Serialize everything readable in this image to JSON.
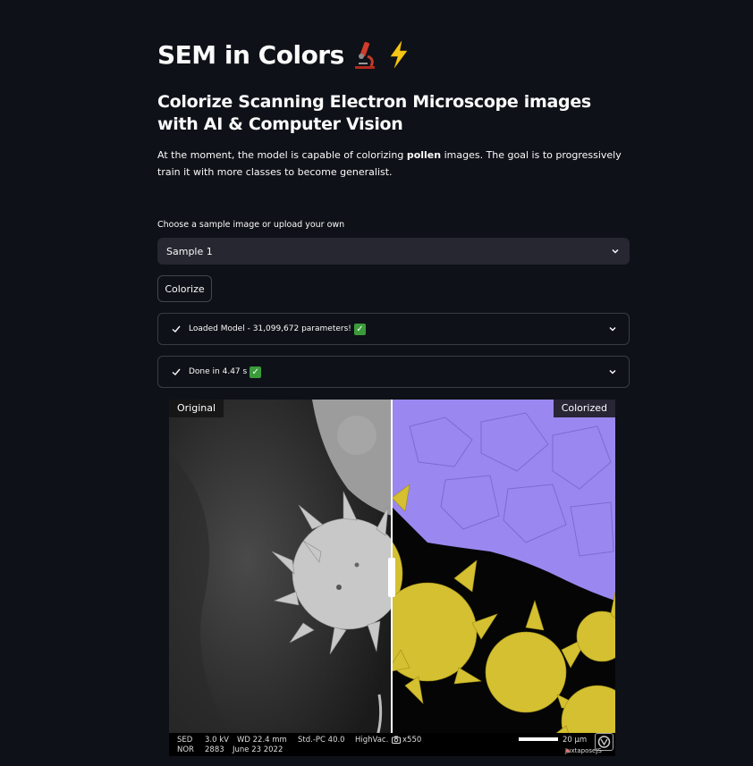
{
  "header": {
    "title": "SEM in Colors",
    "subtitle": "Colorize Scanning Electron Microscope images with AI & Computer Vision",
    "description_pre": "At the moment, the model is capable of colorizing ",
    "description_bold": "pollen",
    "description_post": " images. The goal is to progressively train it with more classes to become generalist."
  },
  "sample_select": {
    "label": "Choose a sample image or upload your own",
    "value": "Sample 1"
  },
  "colorize_button": "Colorize",
  "status_model": "Loaded Model - 31,099,672 parameters!",
  "status_done": "Done in 4.47 s",
  "viewer": {
    "label_left": "Original",
    "label_right": "Colorized",
    "split_position": 0.5,
    "colors": {
      "pollen_top": "#9a88f0",
      "pollen_bottom": "#d4c030"
    },
    "info": {
      "sed": "SED",
      "kv": "3.0 kV",
      "wd": "WD 22.4 mm",
      "std": "Std.-PC 40.0",
      "vac": "HighVac.",
      "mag": "x550",
      "scale": "20 µm",
      "nor": "NOR",
      "num": "2883",
      "date": "June 23 2022",
      "credit": "JuxtaposeJS"
    }
  }
}
